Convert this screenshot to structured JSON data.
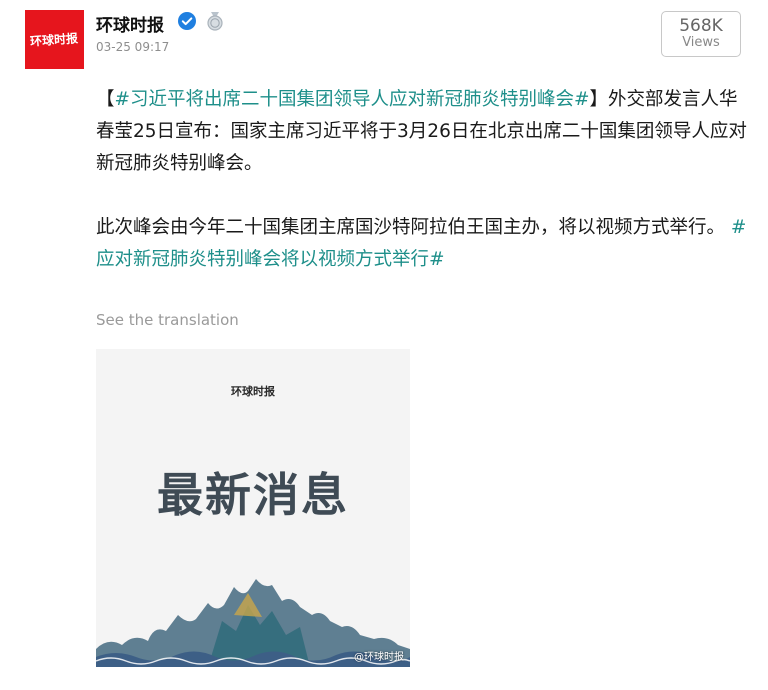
{
  "account": {
    "name": "环球时报",
    "logo_text": "环球时报",
    "brand_color": "#e6151d",
    "verified_icon": "verified-check-icon",
    "medal_icon": "medal-icon"
  },
  "post": {
    "timestamp": "03-25 09:17",
    "views_count": "568K",
    "views_label": "Views",
    "hashtag_1": "#习近平将出席二十国集团领导人应对新冠肺炎特别峰会#",
    "bracket_open": "【",
    "bracket_close": "】",
    "text_1": "外交部发言人华春莹25日宣布：国家主席习近平将于3月26日在北京出席二十国集团领导人应对新冠肺炎特别峰会。",
    "text_2": "此次峰会由今年二十国集团主席国沙特阿拉伯王国主办，将以视频方式举行。 ",
    "hashtag_2": "#应对新冠肺炎特别峰会将以视频方式举行#",
    "hashtag_color": "#1e8f8a",
    "translation_link": "See the translation"
  },
  "image": {
    "logo_text": "环球时报",
    "headline": "最新消息",
    "watermark": "@环球时报"
  }
}
